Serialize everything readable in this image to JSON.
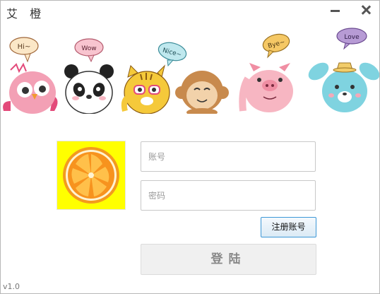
{
  "window": {
    "title": "艾 橙"
  },
  "banner": {
    "bubbles": [
      "Hi~",
      "Wow",
      "Nice~",
      "Bye~",
      "Love"
    ],
    "colors": {
      "owl": "#f3a0b5",
      "panda": "#ffffff",
      "tiger": "#f5c93a",
      "monkey": "#c88a4d",
      "pig": "#f7b6c2",
      "bunny": "#7fd3e0"
    }
  },
  "logo": {
    "icon": "orange-slice-icon",
    "background": "#ffff00"
  },
  "form": {
    "username_placeholder": "账号",
    "password_placeholder": "密码",
    "register_label": "注册账号",
    "login_label": "登陆"
  },
  "footer": {
    "version": "v1.0"
  }
}
